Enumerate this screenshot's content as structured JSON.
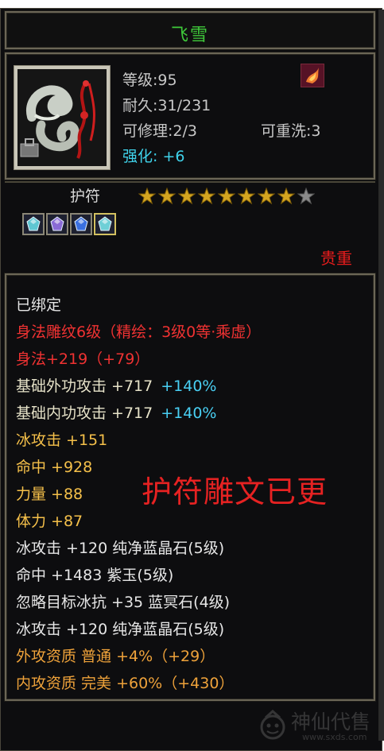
{
  "item": {
    "name": "飞雪",
    "level": "等级:95",
    "durability": "耐久:31/231",
    "repairable": "可修理:2/3",
    "rewashable": "可重洗:3",
    "strengthen": "强化: +6",
    "type": "护符",
    "stars_filled": 8,
    "stars_total": 9,
    "rarity": "贵重"
  },
  "gems": [
    {
      "name": "gem-slot-1",
      "color": "#5fc6d2"
    },
    {
      "name": "gem-slot-2",
      "color": "#8a6bd6"
    },
    {
      "name": "gem-slot-3",
      "color": "#3a6fe0"
    },
    {
      "name": "gem-slot-4",
      "color": "#6ecfd6"
    }
  ],
  "attributes": [
    {
      "text": "已绑定",
      "color": "white"
    },
    {
      "text": "身法雕纹6级（精绘：3级0等·乘虚）",
      "color": "red"
    },
    {
      "text": "身法+219（+79）",
      "color": "red"
    },
    {
      "text": "基础外功攻击 +717",
      "extra": "+140%",
      "color": "pale"
    },
    {
      "text": "基础内功攻击 +717",
      "extra": "+140%",
      "color": "pale"
    },
    {
      "text": "冰攻击 +151",
      "color": "gold"
    },
    {
      "text": "命中 +928",
      "color": "gold"
    },
    {
      "text": "力量 +88",
      "color": "gold"
    },
    {
      "text": "体力 +87",
      "color": "gold"
    },
    {
      "text": "冰攻击 +120 纯净蓝晶石(5级)",
      "color": "white"
    },
    {
      "text": "命中 +1483 紫玉(5级)",
      "color": "white"
    },
    {
      "text": "忽略目标冰抗 +35 蓝冥石(4级)",
      "color": "white"
    },
    {
      "text": "冰攻击 +120 纯净蓝晶石(5级)",
      "color": "white"
    },
    {
      "text": "外攻资质  普通 +4%（+29）",
      "color": "orange"
    },
    {
      "text": "内攻资质  完美 +60%（+430）",
      "color": "orange"
    }
  ],
  "stamp_text": "护符雕文已更",
  "watermark": {
    "text": "神仙代售",
    "url": "www.sxds.com"
  }
}
